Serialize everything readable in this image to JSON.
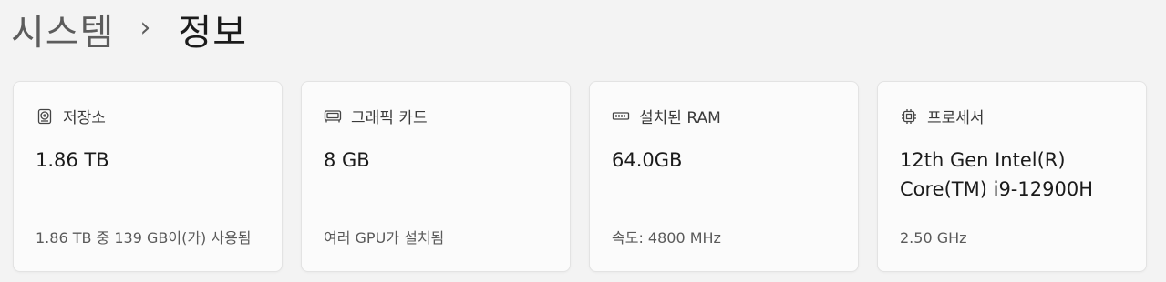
{
  "breadcrumb": {
    "parent": "시스템",
    "separator": "›",
    "current": "정보"
  },
  "cards": [
    {
      "icon": "hard-drive-icon",
      "label": "저장소",
      "value": "1.86 TB",
      "sub": "1.86 TB 중 139 GB이(가) 사용됨"
    },
    {
      "icon": "graphics-card-icon",
      "label": "그래픽 카드",
      "value": "8 GB",
      "sub": "여러 GPU가 설치됨"
    },
    {
      "icon": "ram-icon",
      "label": "설치된 RAM",
      "value": "64.0GB",
      "sub": "속도: 4800 MHz"
    },
    {
      "icon": "processor-icon",
      "label": "프로세서",
      "value": "12th Gen Intel(R) Core(TM) i9-12900H",
      "sub": "2.50 GHz"
    }
  ],
  "colors": {
    "background": "#f3f3f3",
    "card": "#fbfbfb",
    "card_border": "#e3e3e3",
    "text_primary": "#1b1b1b",
    "text_secondary": "#5a5a5a"
  }
}
